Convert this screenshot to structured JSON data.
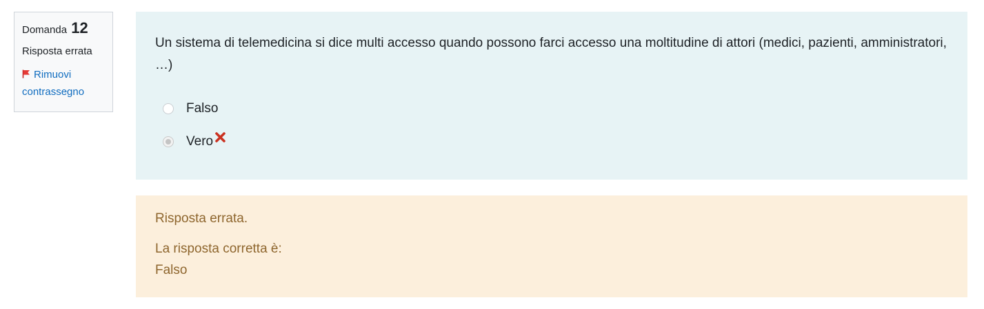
{
  "info": {
    "question_label": "Domanda",
    "question_number": "12",
    "state": "Risposta errata",
    "flag_label": "Rimuovi contrassegno"
  },
  "formulation": {
    "question_text": "Un sistema di telemedicina si dice multi accesso quando possono farci accesso una moltitudine di attori (medici, pazienti, amministratori, …)",
    "answers": [
      {
        "label": "Falso",
        "selected": false
      },
      {
        "label": "Vero",
        "selected": true,
        "mark": "incorrect"
      }
    ]
  },
  "outcome": {
    "feedback": "Risposta errata.",
    "right_answer_intro": "La risposta corretta è:",
    "right_answer": "Falso"
  },
  "colors": {
    "info_bg": "#f8f9fa",
    "formulation_bg": "#e7f3f5",
    "outcome_bg": "#fcefdc",
    "outcome_text": "#8e662e",
    "link": "#0f6cbf",
    "incorrect_mark": "#ca3120",
    "flag": "#d32f2f"
  },
  "icons": {
    "flag": "flag-icon",
    "incorrect": "incorrect-x-icon"
  }
}
